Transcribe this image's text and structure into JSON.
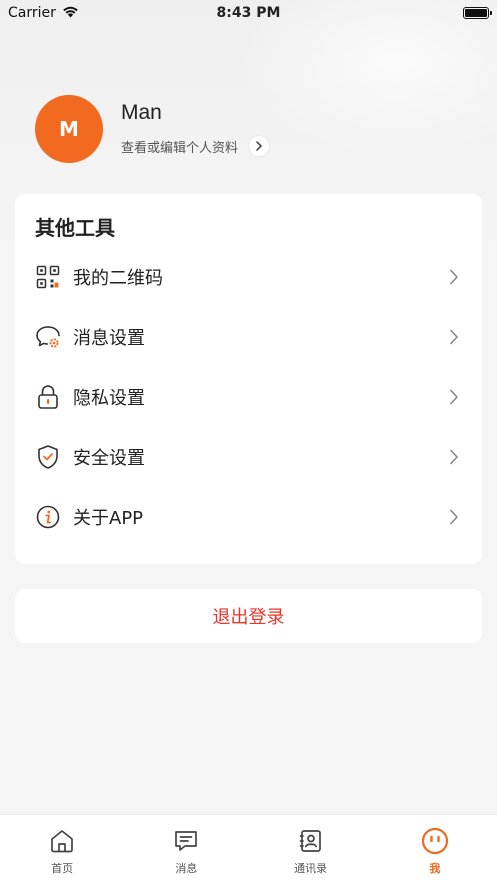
{
  "status_bar": {
    "carrier": "Carrier",
    "time": "8:43 PM"
  },
  "profile": {
    "avatar_letter": "M",
    "name": "Man",
    "subtitle": "查看或编辑个人资料"
  },
  "tools": {
    "title": "其他工具",
    "items": [
      {
        "label": "我的二维码",
        "icon": "qrcode-icon"
      },
      {
        "label": "消息设置",
        "icon": "message-settings-icon"
      },
      {
        "label": "隐私设置",
        "icon": "lock-icon"
      },
      {
        "label": "安全设置",
        "icon": "shield-icon"
      },
      {
        "label": "关于APP",
        "icon": "info-icon"
      }
    ]
  },
  "logout": {
    "label": "退出登录"
  },
  "tab_bar": {
    "tabs": [
      {
        "label": "首页",
        "icon": "home-icon",
        "active": false
      },
      {
        "label": "消息",
        "icon": "message-icon",
        "active": false
      },
      {
        "label": "通讯录",
        "icon": "contacts-icon",
        "active": false
      },
      {
        "label": "我",
        "icon": "profile-icon",
        "active": true
      }
    ]
  },
  "colors": {
    "accent": "#f26a1f",
    "logout": "#e8362b",
    "background": "#f5f5f5"
  }
}
